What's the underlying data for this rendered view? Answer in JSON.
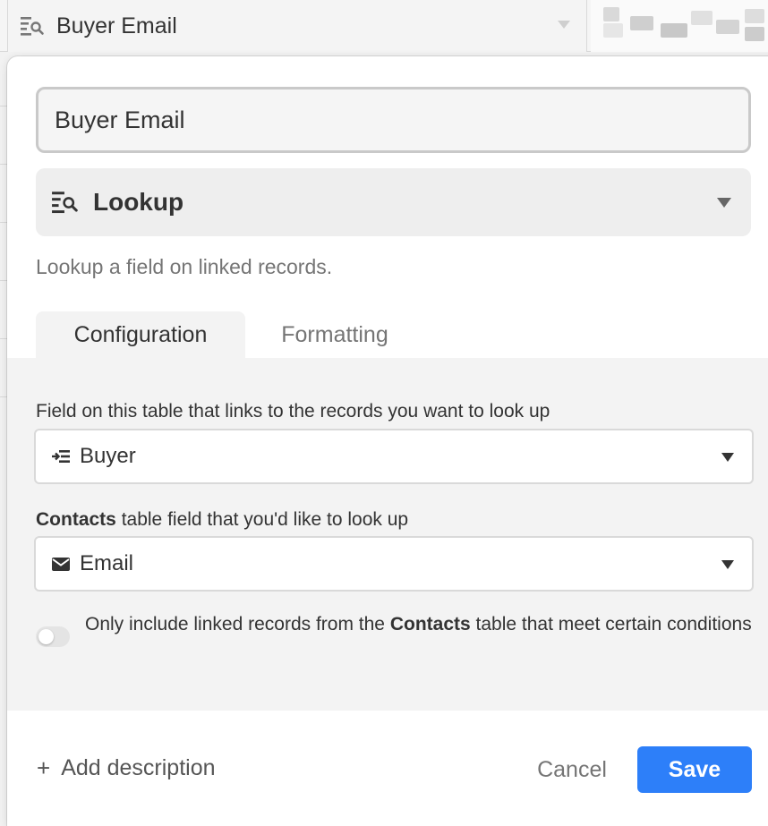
{
  "column_header": {
    "title": "Buyer Email",
    "icon": "lookup-icon"
  },
  "field_name": {
    "value": "Buyer Email"
  },
  "field_type": {
    "label": "Lookup",
    "icon": "lookup-icon",
    "description": "Lookup a field on linked records."
  },
  "tabs": [
    {
      "label": "Configuration",
      "active": true
    },
    {
      "label": "Formatting",
      "active": false
    }
  ],
  "configuration": {
    "link_field_label": "Field on this table that links to the records you want to look up",
    "link_field": {
      "value": "Buyer",
      "icon": "linked-record-icon"
    },
    "lookup_field_label_bold": "Contacts",
    "lookup_field_label_rest": " table field that you'd like to look up",
    "lookup_field": {
      "value": "Email",
      "icon": "envelope-icon"
    },
    "condition_toggle": {
      "on": false,
      "text_before": "Only include linked records from the ",
      "text_bold": "Contacts",
      "text_after": " table that meet certain conditions"
    }
  },
  "footer": {
    "add_description": "Add description",
    "cancel_label": "Cancel",
    "save_label": "Save"
  },
  "colors": {
    "primary": "#2d7ff9",
    "text": "#333333",
    "muted": "#757575"
  }
}
